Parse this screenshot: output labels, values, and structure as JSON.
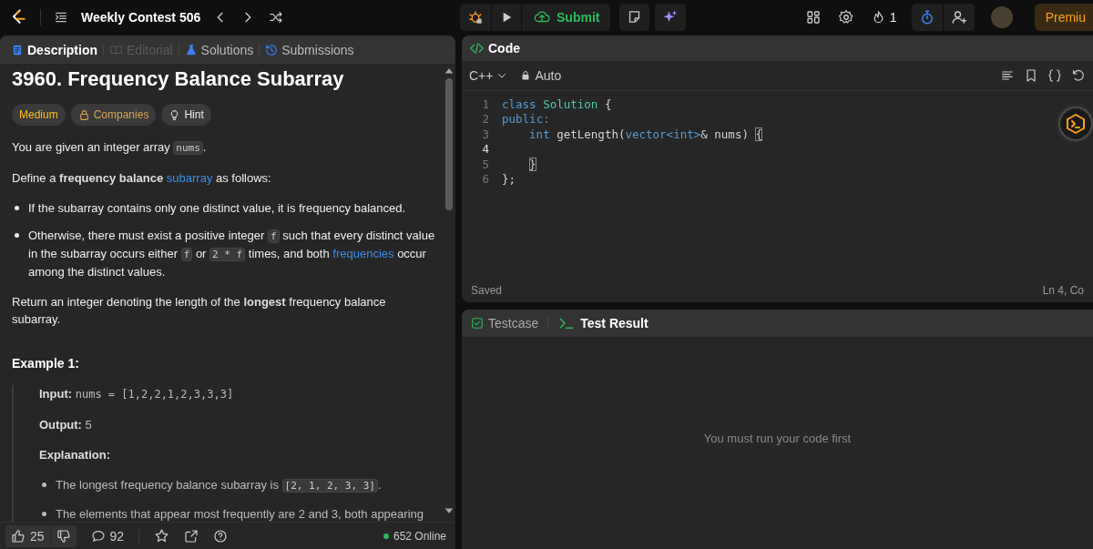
{
  "topbar": {
    "contest_title": "Weekly Contest 506",
    "submit_label": "Submit",
    "streak_count": "1",
    "premium_label": "Premiu"
  },
  "description": {
    "tabs": [
      {
        "label": "Description",
        "selected": true,
        "disabled": false
      },
      {
        "label": "Editorial",
        "selected": false,
        "disabled": true
      },
      {
        "label": "Solutions",
        "selected": false,
        "disabled": false
      },
      {
        "label": "Submissions",
        "selected": false,
        "disabled": false
      }
    ],
    "title": "3960. Frequency Balance Subarray",
    "tags": [
      {
        "kind": "difficulty",
        "label": "Medium"
      },
      {
        "kind": "companies",
        "label": "Companies"
      },
      {
        "kind": "hint",
        "label": "Hint"
      }
    ],
    "blocks": [
      {
        "kind": "paragraph",
        "segments": [
          {
            "kind": "text",
            "text": "You are given an integer array "
          },
          {
            "kind": "code",
            "text": "nums"
          },
          {
            "kind": "text",
            "text": "."
          }
        ]
      },
      {
        "kind": "paragraph",
        "segments": [
          {
            "kind": "text",
            "text": "Define a **frequency balance** "
          },
          {
            "kind": "link",
            "text": "subarray"
          },
          {
            "kind": "text",
            "text": " as follows:"
          }
        ]
      },
      {
        "kind": "bullets",
        "items": [
          [
            {
              "kind": "text",
              "text": "If the subarray contains only one distinct value, it is frequency balanced."
            }
          ],
          [
            {
              "kind": "text",
              "text": "Otherwise, there must exist a positive integer "
            },
            {
              "kind": "code",
              "text": "f"
            },
            {
              "kind": "text",
              "text": " such that every distinct value in the subarray occurs either "
            },
            {
              "kind": "code",
              "text": "f"
            },
            {
              "kind": "text",
              "text": " or "
            },
            {
              "kind": "code",
              "text": "2 * f"
            },
            {
              "kind": "text",
              "text": " times, and both "
            },
            {
              "kind": "link",
              "text": "frequencies"
            },
            {
              "kind": "text",
              "text": " occur among the distinct values."
            }
          ]
        ]
      },
      {
        "kind": "paragraph",
        "segments": [
          {
            "kind": "text",
            "text": "Return an integer denoting the length of the **longest** frequency balance subarray."
          }
        ]
      }
    ],
    "example": {
      "heading": "Example 1:",
      "input_label": "Input:",
      "input_value": "nums = [1,2,2,1,2,3,3,3]",
      "output_label": "Output:",
      "output_value": "5",
      "explanation_label": "Explanation:",
      "bullets": [
        [
          {
            "kind": "text",
            "text": "The longest frequency balance subarray is "
          },
          {
            "kind": "code",
            "text": "[2, 1, 2, 3, 3]"
          },
          {
            "kind": "text",
            "text": "."
          }
        ],
        [
          {
            "kind": "text",
            "text": "The elements that appear most frequently are 2 and 3, both appearing"
          }
        ]
      ]
    },
    "footer": {
      "likes": "25",
      "comments": "92",
      "online": "652 Online"
    }
  },
  "editor": {
    "title": "Code",
    "language": "C++",
    "mode": "Auto",
    "lines": [
      {
        "number": "1",
        "current": false,
        "indented": false,
        "tokens": [
          {
            "kind": "keyword",
            "text": "class"
          },
          {
            "kind": "type",
            "text": " Solution"
          },
          {
            "kind": "plain",
            "text": " {"
          }
        ]
      },
      {
        "number": "2",
        "current": false,
        "indented": false,
        "tokens": [
          {
            "kind": "keyword",
            "text": "public:"
          }
        ]
      },
      {
        "number": "3",
        "current": false,
        "indented": true,
        "tokens": [
          {
            "kind": "keyword",
            "text": "int"
          },
          {
            "kind": "plain",
            "text": " getLength("
          },
          {
            "kind": "keyword",
            "text": "vector<int>"
          },
          {
            "kind": "plain",
            "text": "& nums) "
          },
          {
            "kind": "bracket-match",
            "text": "{"
          }
        ]
      },
      {
        "number": "4",
        "current": true,
        "indented": false
      },
      {
        "number": "5",
        "current": false,
        "indented": true,
        "tokens": [
          {
            "kind": "bracket-match",
            "text": "}"
          }
        ]
      },
      {
        "number": "6",
        "current": false,
        "indented": false,
        "tokens": [
          {
            "kind": "plain",
            "text": "};"
          }
        ]
      }
    ],
    "status": "Saved",
    "cursor": "Ln 4, Co"
  },
  "console": {
    "tabs": [
      {
        "label": "Testcase",
        "selected": false
      },
      {
        "label": "Test Result",
        "selected": true
      }
    ],
    "message": "You must run your code first"
  }
}
